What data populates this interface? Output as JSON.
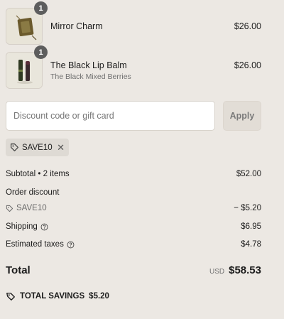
{
  "line_items": [
    {
      "quantity": "1",
      "name": "Mirror Charm",
      "variant": "",
      "price": "$26.00",
      "image_icon": "mirror-charm-product-image"
    },
    {
      "quantity": "1",
      "name": "The Black Lip Balm",
      "variant": "The Black Mixed Berries",
      "price": "$26.00",
      "image_icon": "lip-balm-product-image"
    }
  ],
  "discount": {
    "input_placeholder": "Discount code or gift card",
    "input_value": "",
    "apply_label": "Apply",
    "applied_code": "SAVE10",
    "remove_symbol": "✕"
  },
  "summary": {
    "subtotal_label": "Subtotal • 2 items",
    "subtotal_value": "$52.00",
    "order_discount_label": "Order discount",
    "order_discount_code": "SAVE10",
    "order_discount_value": "− $5.20",
    "shipping_label": "Shipping",
    "shipping_value": "$6.95",
    "taxes_label": "Estimated taxes",
    "taxes_value": "$4.78"
  },
  "total": {
    "label": "Total",
    "currency": "USD",
    "amount": "$58.53"
  },
  "savings": {
    "label": "TOTAL SAVINGS",
    "amount": "$5.20"
  },
  "colors": {
    "background": "#ece8e3",
    "badge": "#5d5d5d",
    "chip": "#dedad4",
    "apply_button": "#e2ddd6"
  }
}
